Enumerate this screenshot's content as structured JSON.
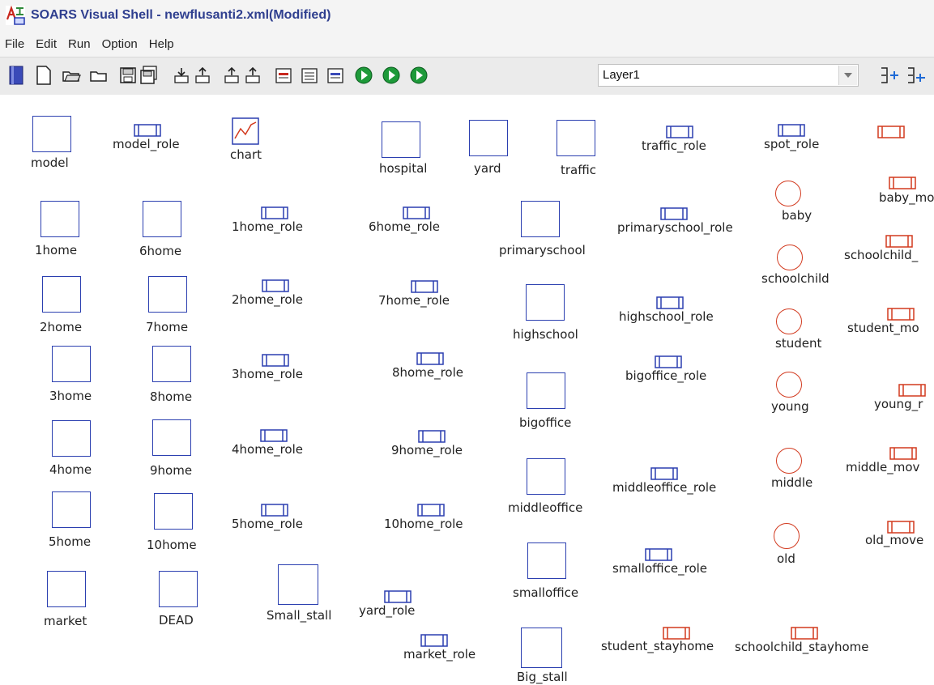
{
  "window": {
    "title": "SOARS Visual Shell - newflusanti2.xml(Modified)"
  },
  "menu": [
    "File",
    "Edit",
    "Run",
    "Option",
    "Help"
  ],
  "toolbar": {
    "buttons": [
      "book-icon",
      "new-file-icon",
      "open-folder-icon",
      "folder-icon",
      "save-icon",
      "save-all-icon",
      "import-icon",
      "export-icon",
      "export-2-icon",
      "export-3-icon",
      "calendar-icon",
      "list-icon",
      "calendar-2-icon",
      "run-icon",
      "run-2-icon",
      "run-3-icon"
    ],
    "layer": "Layer1",
    "end_buttons": [
      "layer-add-icon",
      "layer-insert-icon"
    ]
  },
  "colors": {
    "spot": "#2b3fb0",
    "agent": "#d23a1f"
  },
  "canvas": {
    "objects": {
      "model": "model",
      "model_role": "model_role",
      "chart": "chart",
      "hospital": "hospital",
      "yard": "yard",
      "traffic": "traffic",
      "traffic_role": "traffic_role",
      "spot_role": "spot_role",
      "h1": "1home",
      "h6": "6home",
      "h1r": "1home_role",
      "h6r": "6home_role",
      "primaryschool": "primaryschool",
      "primaryschool_role": "primaryschool_role",
      "baby": "baby",
      "baby_move": "baby_mov",
      "h2": "2home",
      "h7": "7home",
      "h2r": "2home_role",
      "h7r": "7home_role",
      "highschool": "highschool",
      "highschool_role": "highschool_role",
      "schoolchild": "schoolchild",
      "schoolchild_move": "schoolchild_",
      "h3": "3home",
      "h8": "8home",
      "h3r": "3home_role",
      "h8r": "8home_role",
      "bigoffice": "bigoffice",
      "bigoffice_role": "bigoffice_role",
      "student": "student",
      "student_move": "student_mo",
      "h4": "4home",
      "h9": "9home",
      "h4r": "4home_role",
      "h9r": "9home_role",
      "middleoffice": "middleoffice",
      "middleoffice_role": "middleoffice_role",
      "young": "young",
      "young_move": "young_r",
      "h5": "5home",
      "h10": "10home",
      "h5r": "5home_role",
      "h10r": "10home_role",
      "smalloffice": "smalloffice",
      "smalloffice_role": "smalloffice_role",
      "middle": "middle",
      "middle_move": "middle_mov",
      "market": "market",
      "dead": "DEAD",
      "small_stall": "Small_stall",
      "yard_role": "yard_role",
      "market_role": "market_role",
      "big_stall": "Big_stall",
      "student_stayhome": "student_stayhome",
      "schoolchild_stayhome": "schoolchild_stayhome",
      "old": "old",
      "old_move": "old_move"
    }
  }
}
